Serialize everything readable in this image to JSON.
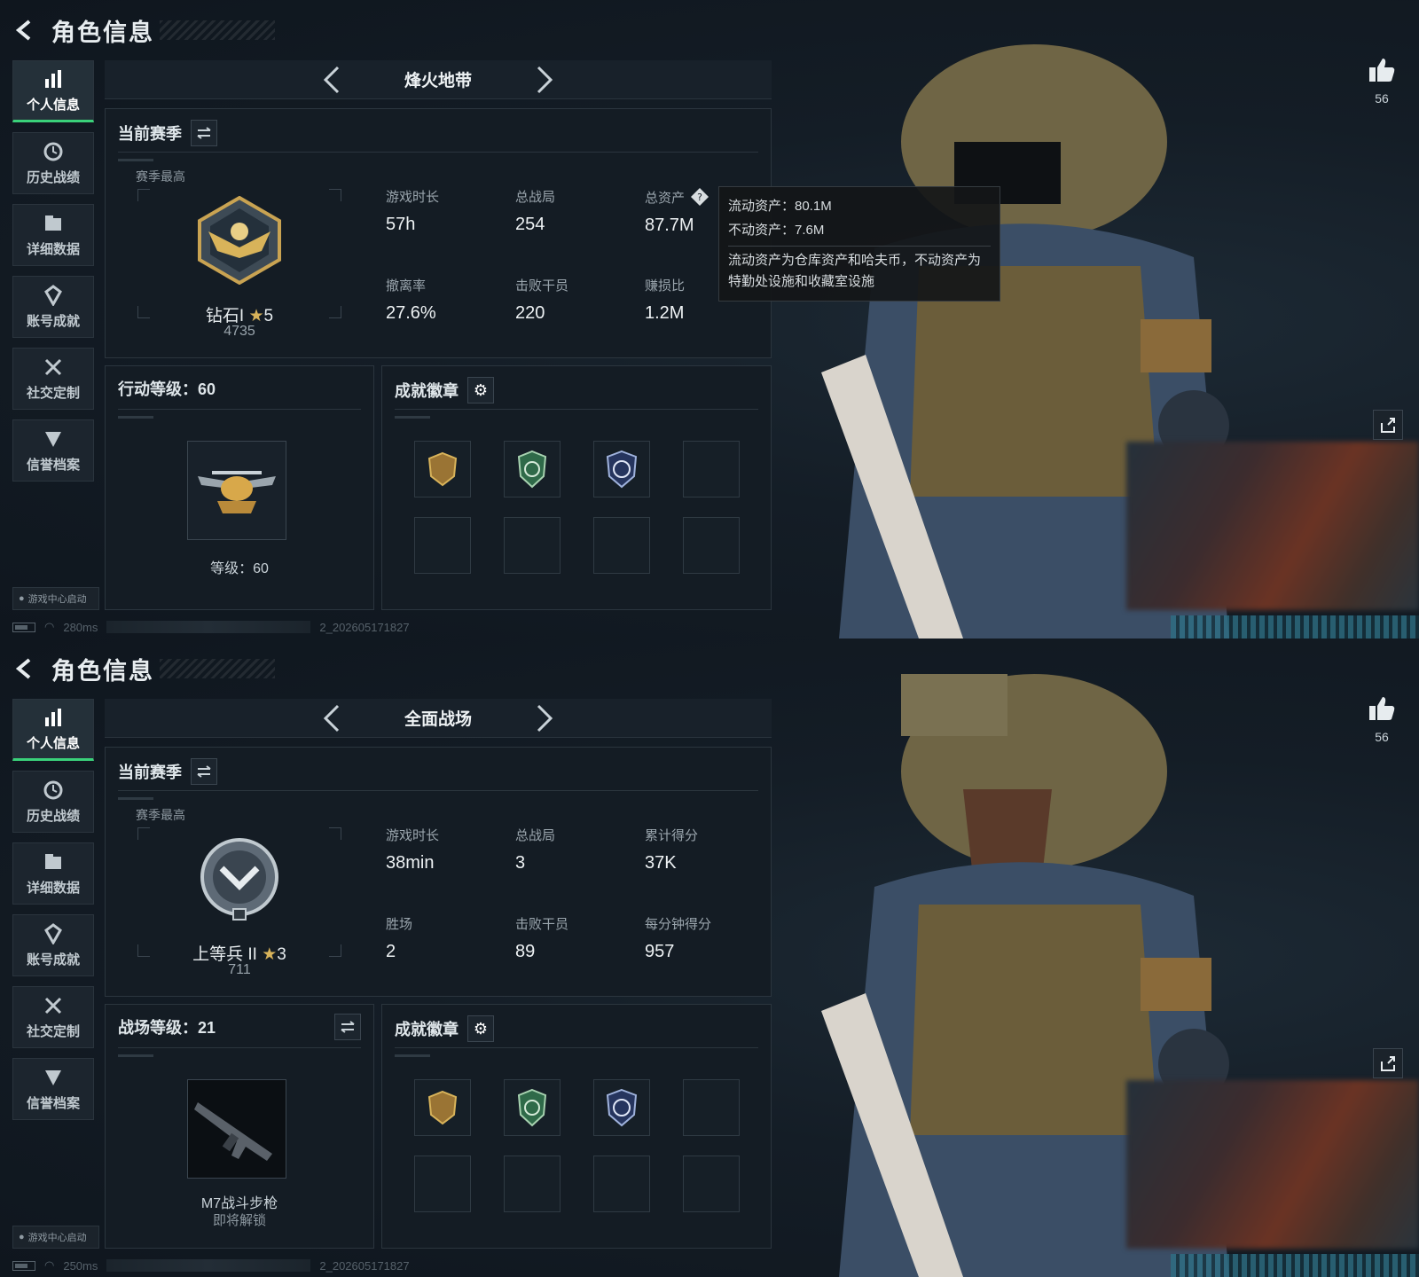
{
  "screens": [
    {
      "header": {
        "title": "角色信息"
      },
      "sidebar": {
        "items": [
          {
            "label": "个人信息",
            "icon": "bar-chart-icon",
            "active": true
          },
          {
            "label": "历史战绩",
            "icon": "history-icon"
          },
          {
            "label": "详细数据",
            "icon": "folder-icon"
          },
          {
            "label": "账号成就",
            "icon": "achievement-icon"
          },
          {
            "label": "社交定制",
            "icon": "tools-icon"
          },
          {
            "label": "信誉档案",
            "icon": "credit-icon"
          }
        ],
        "launch_tag": "游戏中心启动"
      },
      "status": {
        "ping": "280ms",
        "build": "2_202605171827"
      },
      "mode": {
        "name": "烽火地带"
      },
      "season": {
        "title": "当前赛季",
        "best_label": "赛季最高",
        "rank_name": "钻石I",
        "rank_stars": "5",
        "rank_score": "4735",
        "stats": [
          {
            "label": "游戏时长",
            "value": "57h"
          },
          {
            "label": "总战局",
            "value": "254"
          },
          {
            "label": "总资产",
            "value": "87.7M",
            "help": true
          },
          {
            "label": "撤离率",
            "value": "27.6%"
          },
          {
            "label": "击败干员",
            "value": "220"
          },
          {
            "label": "赚损比",
            "value": "1.2M"
          }
        ]
      },
      "tooltip": {
        "line1": "流动资产：80.1M",
        "line2": "不动资产：7.6M",
        "note": "流动资产为仓库资产和哈夫币，不动资产为特勤处设施和收藏室设施"
      },
      "level": {
        "title": "行动等级：60",
        "caption": "等级：60"
      },
      "badges": {
        "title": "成就徽章"
      },
      "likes": "56"
    },
    {
      "header": {
        "title": "角色信息"
      },
      "sidebar": {
        "items": [
          {
            "label": "个人信息",
            "icon": "bar-chart-icon",
            "active": true
          },
          {
            "label": "历史战绩",
            "icon": "history-icon"
          },
          {
            "label": "详细数据",
            "icon": "folder-icon"
          },
          {
            "label": "账号成就",
            "icon": "achievement-icon"
          },
          {
            "label": "社交定制",
            "icon": "tools-icon"
          },
          {
            "label": "信誉档案",
            "icon": "credit-icon"
          }
        ],
        "launch_tag": "游戏中心启动"
      },
      "status": {
        "ping": "250ms",
        "build": "2_202605171827"
      },
      "mode": {
        "name": "全面战场"
      },
      "season": {
        "title": "当前赛季",
        "best_label": "赛季最高",
        "rank_name": "上等兵 II",
        "rank_stars": "3",
        "rank_score": "711",
        "stats": [
          {
            "label": "游戏时长",
            "value": "38min"
          },
          {
            "label": "总战局",
            "value": "3"
          },
          {
            "label": "累计得分",
            "value": "37K"
          },
          {
            "label": "胜场",
            "value": "2"
          },
          {
            "label": "击败干员",
            "value": "89"
          },
          {
            "label": "每分钟得分",
            "value": "957"
          }
        ]
      },
      "level": {
        "title": "战场等级：21",
        "weapon_name": "M7战斗步枪",
        "weapon_status": "即将解锁"
      },
      "badges": {
        "title": "成就徽章"
      },
      "likes": "56"
    }
  ],
  "colors": {
    "accent": "#3ad17a",
    "gold": "#d8b35a",
    "panel": "#141c24"
  }
}
